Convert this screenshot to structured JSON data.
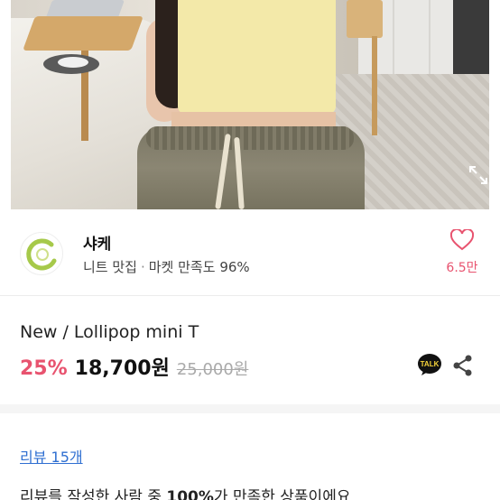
{
  "seller": {
    "name": "샤케",
    "category": "니트 맛집",
    "satisfaction_label": "마켓 만족도",
    "satisfaction_value": "96%",
    "likes": "6.5만"
  },
  "product": {
    "title": "New / Lollipop mini T",
    "discount": "25%",
    "price": "18,700원",
    "original_price": "25,000원",
    "talk_label": "TALK"
  },
  "review": {
    "link_label": "리뷰 15개",
    "summary_prefix": "리뷰를 작성한 사람 중 ",
    "summary_highlight": "100%",
    "summary_suffix": "가 만족한 상품이에요"
  },
  "colors": {
    "accent": "#e8536f",
    "link": "#2f6fd1",
    "logo_green": "#a6c94a"
  }
}
